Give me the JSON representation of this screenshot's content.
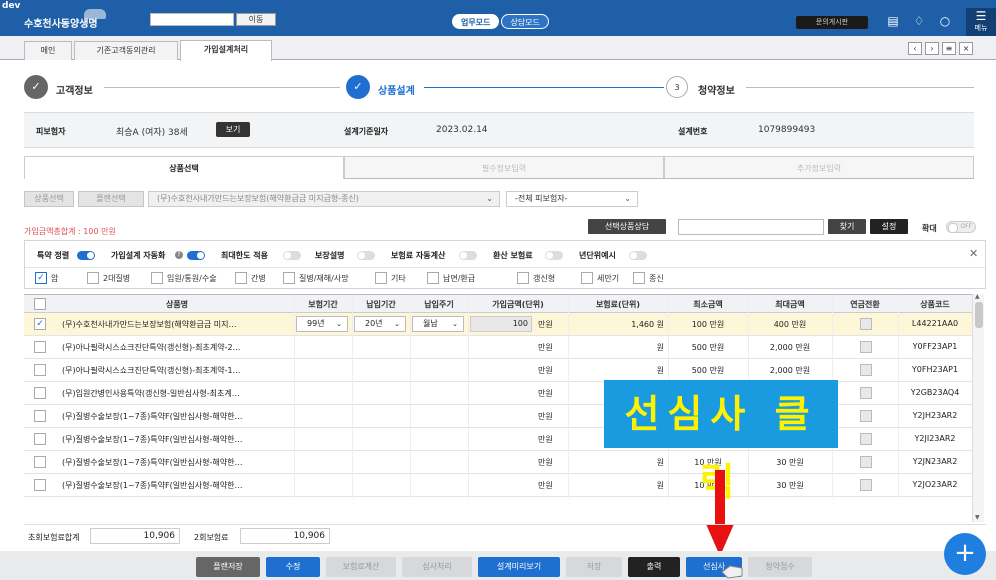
{
  "topbar": {
    "env": "dev",
    "brand": "수호천사동양생명",
    "search_button": "이동",
    "modes": [
      "업무모드",
      "상담모드"
    ],
    "board_button": "문의게시판",
    "menu_label": "메뉴",
    "colors": {
      "bar": "#1f5fa8",
      "accent": "#1f6fd0"
    }
  },
  "tabs": {
    "items": [
      "메인",
      "기존고객동의관리",
      "가입설계처리"
    ],
    "active_index": 2,
    "nav": [
      "‹",
      "›",
      "≡",
      "×"
    ]
  },
  "steps": [
    {
      "label": "고객정보",
      "state": "done"
    },
    {
      "label": "상품설계",
      "state": "active"
    },
    {
      "num": "3",
      "label": "청약정보",
      "state": "pending"
    }
  ],
  "info": {
    "insured_label": "피보험자",
    "insured_value": "최승A (여자) 38세",
    "view_button": "보기",
    "date_label": "설계기준일자",
    "date_value": "2023.02.14",
    "design_no_label": "설계번호",
    "design_no_value": "1079899493"
  },
  "product_tabs": [
    "상품선택",
    "필수정보입력",
    "추가정보입력"
  ],
  "selector": {
    "product_select_btn": "상품선택",
    "plan_select_btn": "플랜선택",
    "product_name": "(무)수호천사내가만드는보장보험(해약환급금 미지급형-종신)",
    "insured_filter": "-전체 피보험자-"
  },
  "toolbar": {
    "total_amount": "가입금액총합계 : 100 만원",
    "selected_consult": "선택상품상담",
    "find_button": "찾기",
    "settings_button": "설정",
    "zoom_label": "확대",
    "zoom_state": "OFF"
  },
  "toggles": [
    {
      "label": "특약 정렬",
      "on": true
    },
    {
      "label": "가입설계 자동화",
      "on": true,
      "help": "?"
    },
    {
      "label": "최대한도 적용",
      "on": false
    },
    {
      "label": "보장설명",
      "on": false
    },
    {
      "label": "보험료 자동계산",
      "on": false
    },
    {
      "label": "환산 보험료",
      "on": false
    },
    {
      "label": "년단위예시",
      "on": false
    }
  ],
  "categories": [
    {
      "label": "암",
      "checked": true
    },
    {
      "label": "2대질병",
      "checked": false
    },
    {
      "label": "입원/통원/수술",
      "checked": false
    },
    {
      "label": "간병",
      "checked": false
    },
    {
      "label": "질병/재해/사망",
      "checked": false
    },
    {
      "label": "기타",
      "checked": false
    },
    {
      "label": "납면/환급",
      "checked": false
    },
    {
      "label": "갱신형",
      "checked": false
    },
    {
      "label": "세만기",
      "checked": false
    },
    {
      "label": "종신",
      "checked": false
    }
  ],
  "table": {
    "headers": [
      "상품명",
      "보험기간",
      "납입기간",
      "납입주기",
      "가입금액(단위)",
      "보험료(단위)",
      "최소금액",
      "최대금액",
      "연금전환",
      "상품코드"
    ],
    "rows": [
      {
        "name": "(무)수호천사내가만드는보장보험(해약환급금 미지…",
        "period": "99년",
        "pay": "20년",
        "cycle": "월납",
        "amount": "100",
        "amount_unit": "만원",
        "premium": "1,460 원",
        "min": "100 만원",
        "max": "400 만원",
        "code": "L44221AA0",
        "selected": true
      },
      {
        "name": "(무)아나필락시스쇼크진단특약(갱신형)-최초계약-2…",
        "period": "",
        "pay": "",
        "cycle": "",
        "amount": "",
        "amount_unit": "만원",
        "premium": "원",
        "min": "500 만원",
        "max": "2,000 만원",
        "code": "Y0FF23AP1",
        "selected": false
      },
      {
        "name": "(무)아나필락시스쇼크진단특약(갱신형)-최초계약-1…",
        "period": "",
        "pay": "",
        "cycle": "",
        "amount": "",
        "amount_unit": "만원",
        "premium": "원",
        "min": "500 만원",
        "max": "2,000 만원",
        "code": "Y0FH23AP1",
        "selected": false
      },
      {
        "name": "(무)입원간병인사용특약(갱신형-일반심사형-최초계…",
        "period": "",
        "pay": "",
        "cycle": "",
        "amount": "",
        "amount_unit": "만원",
        "premium": "",
        "min": "",
        "max": "",
        "code": "Y2GB23AQ4",
        "selected": false
      },
      {
        "name": "(무)질병수술보장(1~7종)특약F(일반심사형-해약한…",
        "period": "",
        "pay": "",
        "cycle": "",
        "amount": "",
        "amount_unit": "만원",
        "premium": "",
        "min": "",
        "max": "",
        "code": "Y2JH23AR2",
        "selected": false
      },
      {
        "name": "(무)질병수술보장(1~7종)특약F(일반심사형-해약한…",
        "period": "",
        "pay": "",
        "cycle": "",
        "amount": "",
        "amount_unit": "만원",
        "premium": "",
        "min": "",
        "max": "",
        "code": "Y2JI23AR2",
        "selected": false
      },
      {
        "name": "(무)질병수술보장(1~7종)특약F(일반심사형-해약한…",
        "period": "",
        "pay": "",
        "cycle": "",
        "amount": "",
        "amount_unit": "만원",
        "premium": "원",
        "min": "10 만원",
        "max": "30 만원",
        "code": "Y2JN23AR2",
        "selected": false
      },
      {
        "name": "(무)질병수술보장(1~7종)특약F(일반심사형-해약한…",
        "period": "",
        "pay": "",
        "cycle": "",
        "amount": "",
        "amount_unit": "만원",
        "premium": "원",
        "min": "10 만원",
        "max": "30 만원",
        "code": "Y2JO23AR2",
        "selected": false
      }
    ]
  },
  "totals": {
    "first_label": "초회보험료합계",
    "first_value": "10,906",
    "second_label": "2회보험료",
    "second_value": "10,906"
  },
  "callout": "선심사 클릭",
  "bottom_buttons": [
    {
      "label": "플랜저장",
      "style": "gray"
    },
    {
      "label": "수정",
      "style": "blue"
    },
    {
      "label": "보험료계산",
      "style": "light"
    },
    {
      "label": "심사처리",
      "style": "light"
    },
    {
      "label": "설계미리보기",
      "style": "blue"
    },
    {
      "label": "저장",
      "style": "light"
    },
    {
      "label": "출력",
      "style": "dark"
    },
    {
      "label": "선심사",
      "style": "blue"
    },
    {
      "label": "청약접수",
      "style": "light"
    }
  ],
  "fab_symbol": "+"
}
